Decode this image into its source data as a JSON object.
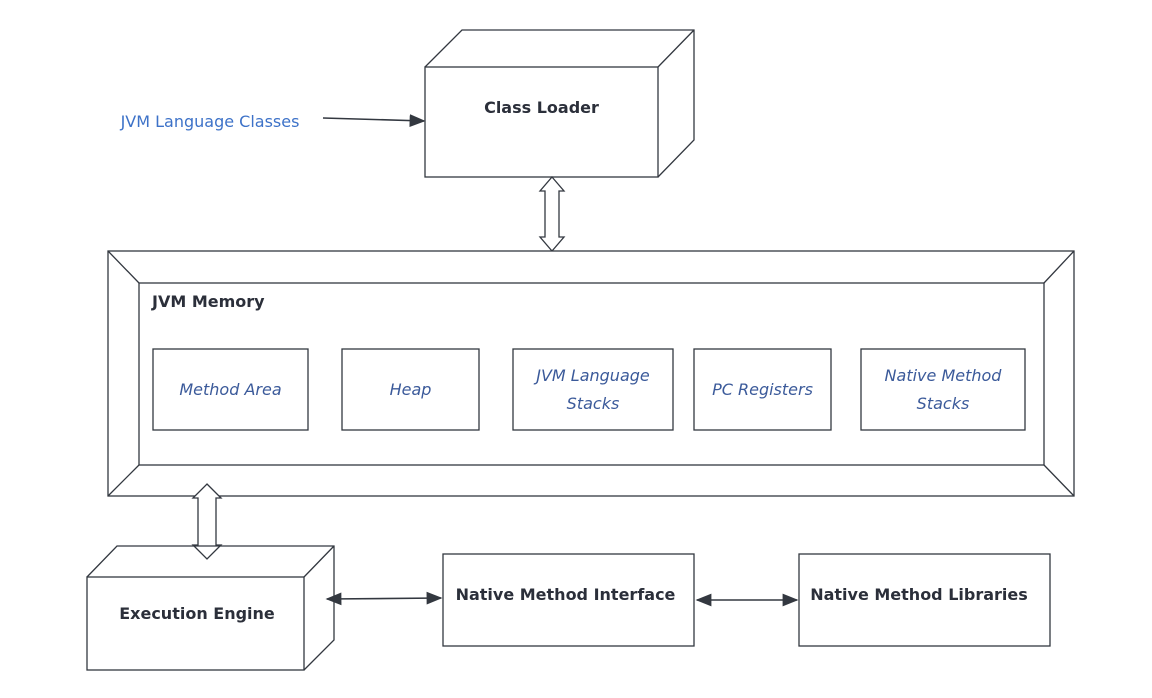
{
  "input_label": "JVM Language Classes",
  "class_loader": "Class Loader",
  "jvm_memory": {
    "title": "JVM Memory",
    "areas": [
      "Method Area",
      "Heap",
      "JVM Language Stacks",
      "PC Registers",
      "Native Method Stacks"
    ]
  },
  "execution_engine": "Execution Engine",
  "native_interface": "Native Method Interface",
  "native_libraries": "Native Method Libraries",
  "colors": {
    "line": "#333840",
    "text": "#2b2f3a",
    "italic_text": "#3b5a9a",
    "input_text": "#3d72c8"
  }
}
